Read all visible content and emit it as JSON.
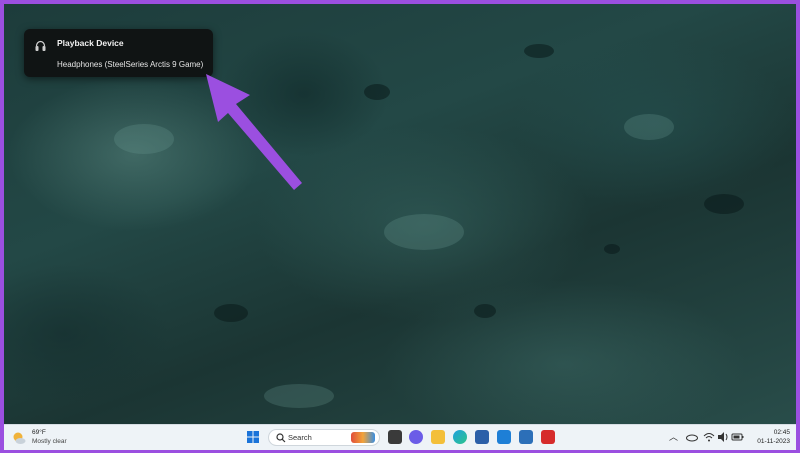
{
  "popup": {
    "title": "Playback Device",
    "device": "Headphones (SteelSeries Arctis 9 Game)",
    "icon": "headphones-icon"
  },
  "annotation": {
    "arrow_color": "#9b4fe0"
  },
  "taskbar": {
    "weather": {
      "temperature": "69°F",
      "condition": "Mostly clear",
      "icon": "moon-cloud-icon"
    },
    "search": {
      "label": "Search"
    },
    "pinned_apps": [
      "windows-start-icon",
      "search-icon",
      "chat-icon",
      "file-explorer-icon",
      "edge-icon",
      "store-icon",
      "app-l-icon",
      "mcafee-icon"
    ],
    "tray": {
      "icons": [
        "chevron-up-icon",
        "onedrive-icon",
        "wifi-icon",
        "volume-icon",
        "battery-icon"
      ]
    },
    "clock": {
      "time": "02:45",
      "date": "01-11-2023"
    }
  },
  "colors": {
    "frame_border": "#9b4fe0",
    "taskbar_bg": "#eef3f7",
    "popup_bg": "#101414",
    "desktop_bg": "#234846"
  }
}
